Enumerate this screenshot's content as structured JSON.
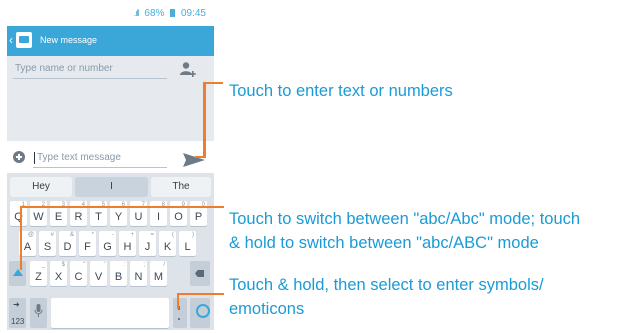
{
  "status": {
    "signal": ".ıll",
    "battery": "68%",
    "time": "09:45"
  },
  "app": {
    "title": "New message"
  },
  "compose": {
    "recipient_placeholder": "Type name or number",
    "message_placeholder": "Type text message"
  },
  "keyboard": {
    "suggestions": [
      "Hey",
      "I",
      "The"
    ],
    "row1": [
      {
        "main": "Q",
        "sub": "1"
      },
      {
        "main": "W",
        "sub": "2"
      },
      {
        "main": "E",
        "sub": "3"
      },
      {
        "main": "R",
        "sub": "4"
      },
      {
        "main": "T",
        "sub": "5"
      },
      {
        "main": "Y",
        "sub": "6"
      },
      {
        "main": "U",
        "sub": "7"
      },
      {
        "main": "I",
        "sub": "8"
      },
      {
        "main": "O",
        "sub": "9"
      },
      {
        "main": "P",
        "sub": "0"
      }
    ],
    "row2": [
      {
        "main": "A",
        "sub": "@"
      },
      {
        "main": "S",
        "sub": "#"
      },
      {
        "main": "D",
        "sub": "&"
      },
      {
        "main": "F",
        "sub": "*"
      },
      {
        "main": "G",
        "sub": "-"
      },
      {
        "main": "H",
        "sub": "+"
      },
      {
        "main": "J",
        "sub": "="
      },
      {
        "main": "K",
        "sub": "("
      },
      {
        "main": "L",
        "sub": ")"
      }
    ],
    "row3": [
      {
        "main": "Z",
        "sub": "_"
      },
      {
        "main": "X",
        "sub": "$"
      },
      {
        "main": "C",
        "sub": "\""
      },
      {
        "main": "V",
        "sub": "'"
      },
      {
        "main": "B",
        "sub": ":"
      },
      {
        "main": "N",
        "sub": ";"
      },
      {
        "main": "M",
        "sub": "/"
      }
    ],
    "symbol_key_label": "123"
  },
  "callouts": {
    "enter_text": "Touch to enter text or numbers",
    "switch_mode_line1": "Touch to switch between \"abc/Abc\" mode; touch",
    "switch_mode_line2": "& hold to switch between \"abc/ABC\" mode",
    "symbols_line1": "Touch & hold, then select to enter symbols/",
    "symbols_line2": "emoticons"
  },
  "colors": {
    "accent": "#3ba6d8",
    "callout_text": "#1a9bd7",
    "callout_line": "#f07d2c"
  }
}
